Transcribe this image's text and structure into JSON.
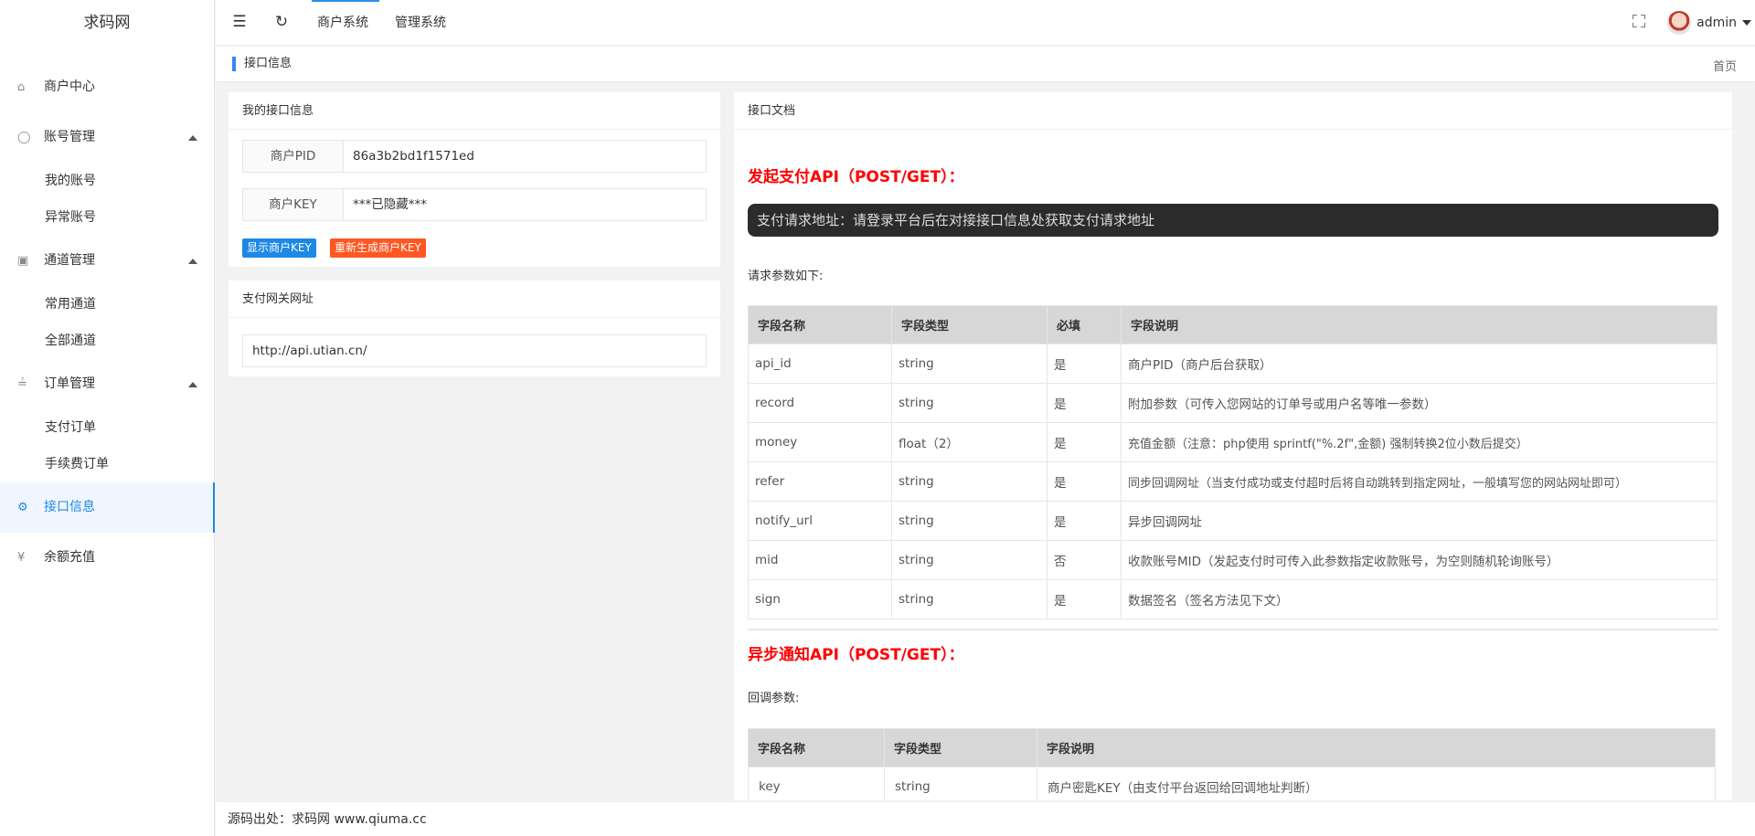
{
  "app": {
    "logo": "求码网"
  },
  "sidebar": {
    "items": [
      {
        "label": "商户中心",
        "icon": "home-icon"
      },
      {
        "label": "账号管理",
        "icon": "user-icon",
        "children": [
          "我的账号",
          "异常账号"
        ]
      },
      {
        "label": "通道管理",
        "icon": "apps-icon",
        "children": [
          "常用通道",
          "全部通道"
        ]
      },
      {
        "label": "订单管理",
        "icon": "chart-icon",
        "children": [
          "支付订单",
          "手续费订单"
        ]
      },
      {
        "label": "接口信息",
        "icon": "gear-icon",
        "active": true
      },
      {
        "label": "余额充值",
        "icon": "yen-icon"
      }
    ]
  },
  "header": {
    "tabs": [
      "商户系统",
      "管理系统"
    ],
    "username": "admin"
  },
  "breadcrumb": {
    "current": "接口信息",
    "home": "首页"
  },
  "my_api": {
    "title": "我的接口信息",
    "pid_label": "商户PID",
    "pid_value": "86a3b2bd1f1571ed",
    "key_label": "商户KEY",
    "key_value": "***已隐藏***",
    "show_key_button": "显示商户KEY",
    "regen_key_button": "重新生成商户KEY"
  },
  "gateway": {
    "title": "支付网关网址",
    "url": "http://api.utian.cn/"
  },
  "doc": {
    "title": "接口文档",
    "pay_api_title": "发起支付API（POST/GET）：",
    "pay_request_url": "支付请求地址：请登录平台后在对接接口信息处获取支付请求地址",
    "request_params_label": "请求参数如下:",
    "request_table": {
      "headers": [
        "字段名称",
        "字段类型",
        "必填",
        "字段说明"
      ],
      "rows": [
        [
          "api_id",
          "string",
          "是",
          "商户PID（商户后台获取）"
        ],
        [
          "record",
          "string",
          "是",
          "附加参数（可传入您网站的订单号或用户名等唯一参数）"
        ],
        [
          "money",
          "float（2）",
          "是",
          "充值金额（注意：php使用 sprintf(\"%.2f\",金额) 强制转换2位小数后提交）"
        ],
        [
          "refer",
          "string",
          "是",
          "同步回调网址（当支付成功或支付超时后将自动跳转到指定网址，一般填写您的网站网址即可）"
        ],
        [
          "notify_url",
          "string",
          "是",
          "异步回调网址"
        ],
        [
          "mid",
          "string",
          "否",
          "收款账号MID（发起支付时可传入此参数指定收款账号，为空则随机轮询账号）"
        ],
        [
          "sign",
          "string",
          "是",
          "数据签名（签名方法见下文）"
        ]
      ]
    },
    "notify_api_title": "异步通知API（POST/GET）：",
    "callback_params_label": "回调参数:",
    "callback_table": {
      "headers": [
        "字段名称",
        "字段类型",
        "字段说明"
      ],
      "rows": [
        [
          "key",
          "string",
          "商户密匙KEY（由支付平台返回给回调地址判断）"
        ]
      ]
    }
  },
  "footer": {
    "text": "源码出处：求码网 www.qiuma.cc"
  }
}
